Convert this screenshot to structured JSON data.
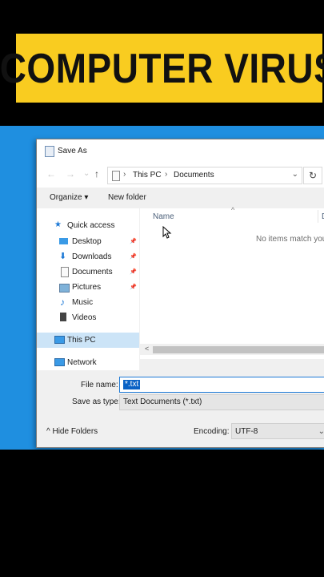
{
  "banner": {
    "title": "COMPUTER VIRUS"
  },
  "window": {
    "title": "Save As",
    "address": {
      "crumb1": "This PC",
      "crumb2": "Documents",
      "sep": "›"
    },
    "nav_glyphs": {
      "back": "←",
      "forward": "→",
      "recent": "⌄",
      "up": "↑",
      "refresh": "↻",
      "dropdown": "⌄"
    },
    "toolbar": {
      "organize": "Organize ▾",
      "new_folder": "New folder"
    },
    "sidebar": {
      "quick_access": "Quick access",
      "items": [
        {
          "label": "Desktop",
          "pinned": "📌"
        },
        {
          "label": "Downloads",
          "pinned": "📌"
        },
        {
          "label": "Documents",
          "pinned": "📌"
        },
        {
          "label": "Pictures",
          "pinned": "📌"
        },
        {
          "label": "Music"
        },
        {
          "label": "Videos"
        }
      ],
      "this_pc": "This PC",
      "network": "Network"
    },
    "content": {
      "col_name": "Name",
      "col_date": "D",
      "sort_glyph": "^",
      "empty_message": "No items match you"
    },
    "scroll_left": "<",
    "form": {
      "file_name_label": "File name:",
      "file_name_value": "*.txt",
      "save_type_label": "Save as type:",
      "save_type_value": "Text Documents (*.txt)",
      "hide_folders": "^  Hide Folders",
      "encoding_label": "Encoding:",
      "encoding_value": "UTF-8",
      "encoding_dd": "⌄"
    }
  },
  "colors": {
    "banner": "#f9cc20",
    "desktop": "#1f8fe0",
    "selection": "#0a62c5",
    "nav_selected": "#cce4f7"
  }
}
